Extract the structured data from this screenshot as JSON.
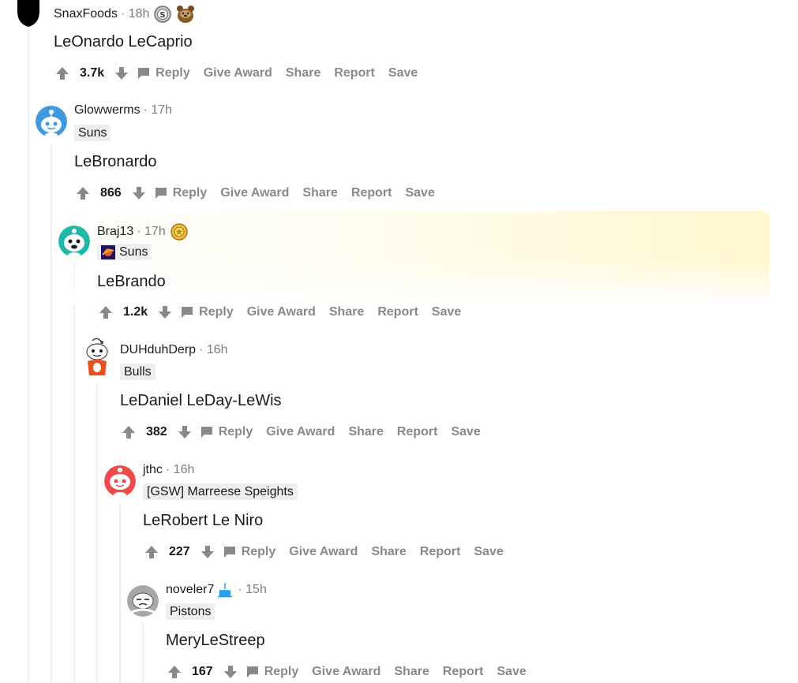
{
  "colors": {
    "action_gray": "#878a8c",
    "flair_bg": "#edeff1",
    "threadline": "#edeff1",
    "highlight": "#fff6c8"
  },
  "actions": {
    "reply": "Reply",
    "give_award": "Give Award",
    "share": "Share",
    "report": "Report",
    "save": "Save"
  },
  "comments": [
    {
      "user": "SnaxFoods",
      "time": "· 18h",
      "flair": "",
      "body": "LeOnardo LeCaprio",
      "score": "3.7k",
      "avatar_icon": "snoo-avatar-black-icon",
      "badges": [
        "silver-award-icon",
        "bear-award-icon"
      ]
    },
    {
      "user": "Glowwerms",
      "time": "· 17h",
      "flair": "Suns",
      "body": "LeBronardo",
      "score": "866",
      "avatar_icon": "snoo-avatar-blue-icon",
      "badges": []
    },
    {
      "user": "Braj13",
      "time": "· 17h",
      "flair": "Suns",
      "body": "LeBrando",
      "score": "1.2k",
      "avatar_icon": "snoo-avatar-teal-icon",
      "badges": [
        "gold-award-icon"
      ],
      "flair_icon": "suns-logo-icon"
    },
    {
      "user": "DUHduhDerp",
      "time": "· 16h",
      "flair": "Bulls",
      "body": "LeDaniel LeDay-LeWis",
      "score": "382",
      "avatar_icon": "snoo-avatar-orange-icon",
      "badges": []
    },
    {
      "user": "jthc",
      "time": "· 16h",
      "flair": "[GSW] Marreese Speights",
      "body": "LeRobert Le Niro",
      "score": "227",
      "avatar_icon": "snoo-avatar-red-icon",
      "badges": []
    },
    {
      "user": "noveler7",
      "time": "· 15h",
      "flair": "Pistons",
      "body": "MeryLeStreep",
      "score": "167",
      "avatar_icon": "snoo-avatar-gray-icon",
      "badges": [
        "cake-day-icon"
      ]
    }
  ]
}
